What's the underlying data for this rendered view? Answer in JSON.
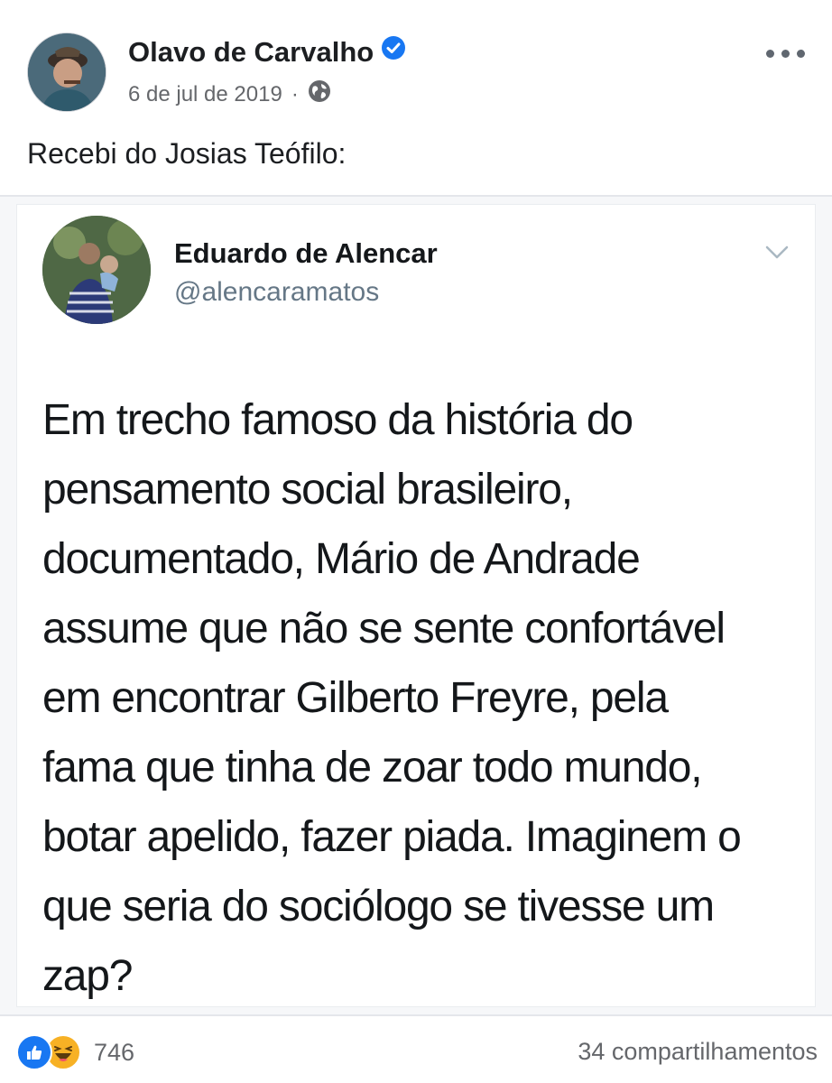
{
  "post": {
    "author": {
      "name": "Olavo de Carvalho",
      "verified": true,
      "avatar_icon": "user-avatar"
    },
    "date": "6 de jul de 2019",
    "separator": "·",
    "privacy_icon": "globe-icon",
    "more_icon": "more-options-icon",
    "caption": "Recebi do Josias Teófilo:"
  },
  "tweet": {
    "name": "Eduardo de Alencar",
    "handle": "@alencaramatos",
    "menu_icon": "chevron-down-icon",
    "text_lines": [
      "Em trecho famoso da história do",
      "pensamento social brasileiro,",
      "documentado, Mário de Andrade",
      "assume que não se sente confortável",
      "em encontrar Gilberto Freyre, pela",
      "fama que tinha de zoar todo mundo,",
      "botar apelido, fazer piada. Imaginem o",
      "que seria do sociólogo se tivesse um",
      "zap?"
    ]
  },
  "footer": {
    "reactions": [
      "like",
      "haha"
    ],
    "reaction_count": "746",
    "shares": "34 compartilhamentos"
  },
  "colors": {
    "verified_badge": "#1877f2",
    "like": "#1877f2",
    "haha": "#f7b125",
    "meta_text": "#65676b"
  }
}
